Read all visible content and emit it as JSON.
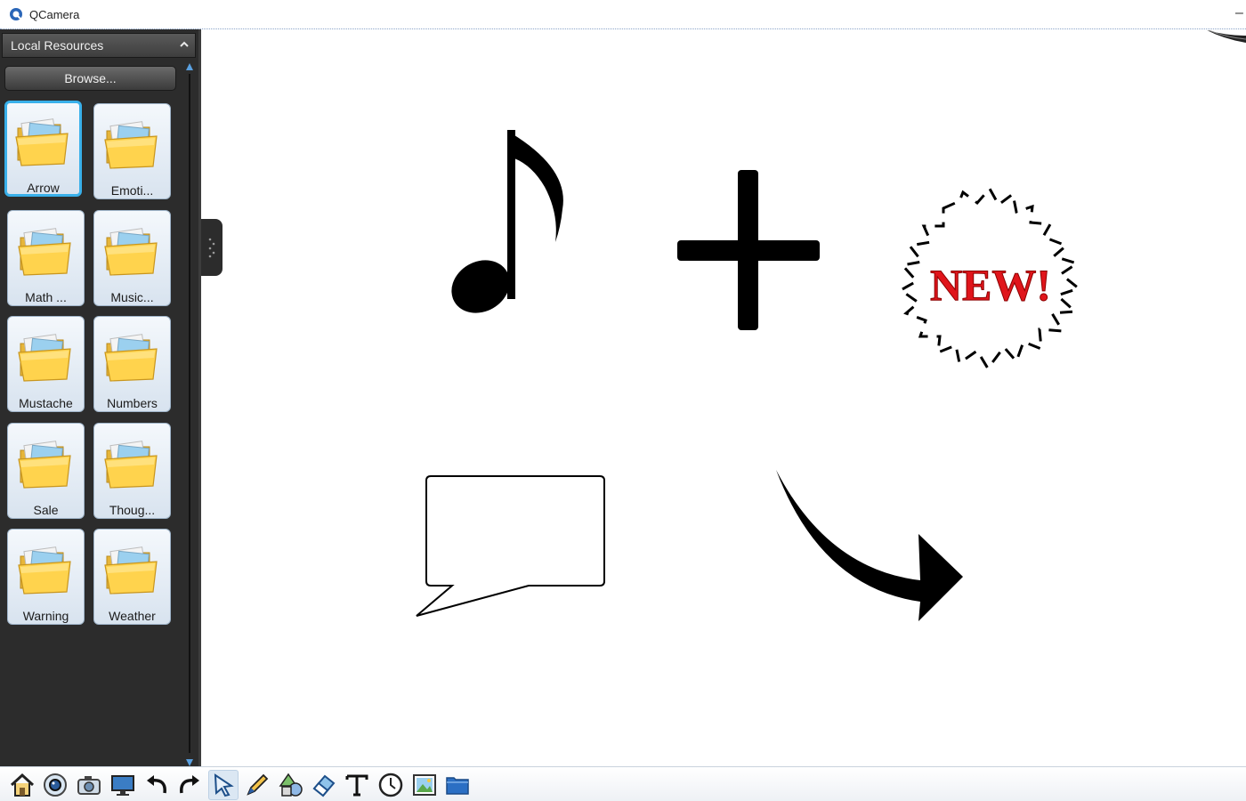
{
  "window": {
    "title": "QCamera",
    "minimize_label": "–"
  },
  "sidebar": {
    "panel_title": "Local Resources",
    "browse_label": "Browse...",
    "folders": [
      {
        "label": "Arrow",
        "selected": true
      },
      {
        "label": "Emoti..."
      },
      {
        "label": "Math ..."
      },
      {
        "label": "Music..."
      },
      {
        "label": "Mustache"
      },
      {
        "label": "Numbers"
      },
      {
        "label": "Sale"
      },
      {
        "label": "Thoug..."
      },
      {
        "label": "Warning"
      },
      {
        "label": "Weather"
      }
    ]
  },
  "canvas": {
    "stickers": [
      {
        "type": "music-note-icon"
      },
      {
        "type": "plus-icon"
      },
      {
        "type": "new-badge",
        "text": "NEW!"
      },
      {
        "type": "speech-bubble-icon"
      },
      {
        "type": "curved-arrow-icon"
      }
    ]
  },
  "toolbar": {
    "tools": [
      "home",
      "camera",
      "snapshot",
      "screen",
      "undo",
      "redo",
      "select",
      "pen",
      "shapes",
      "eraser",
      "text",
      "timer",
      "image",
      "folder"
    ],
    "active_tool": "select"
  },
  "colors": {
    "sidebar_bg": "#2c2c2c",
    "selection_accent": "#39b0ea",
    "badge_red": "#e0151b",
    "scroll_arrow": "#5aa0e0"
  }
}
